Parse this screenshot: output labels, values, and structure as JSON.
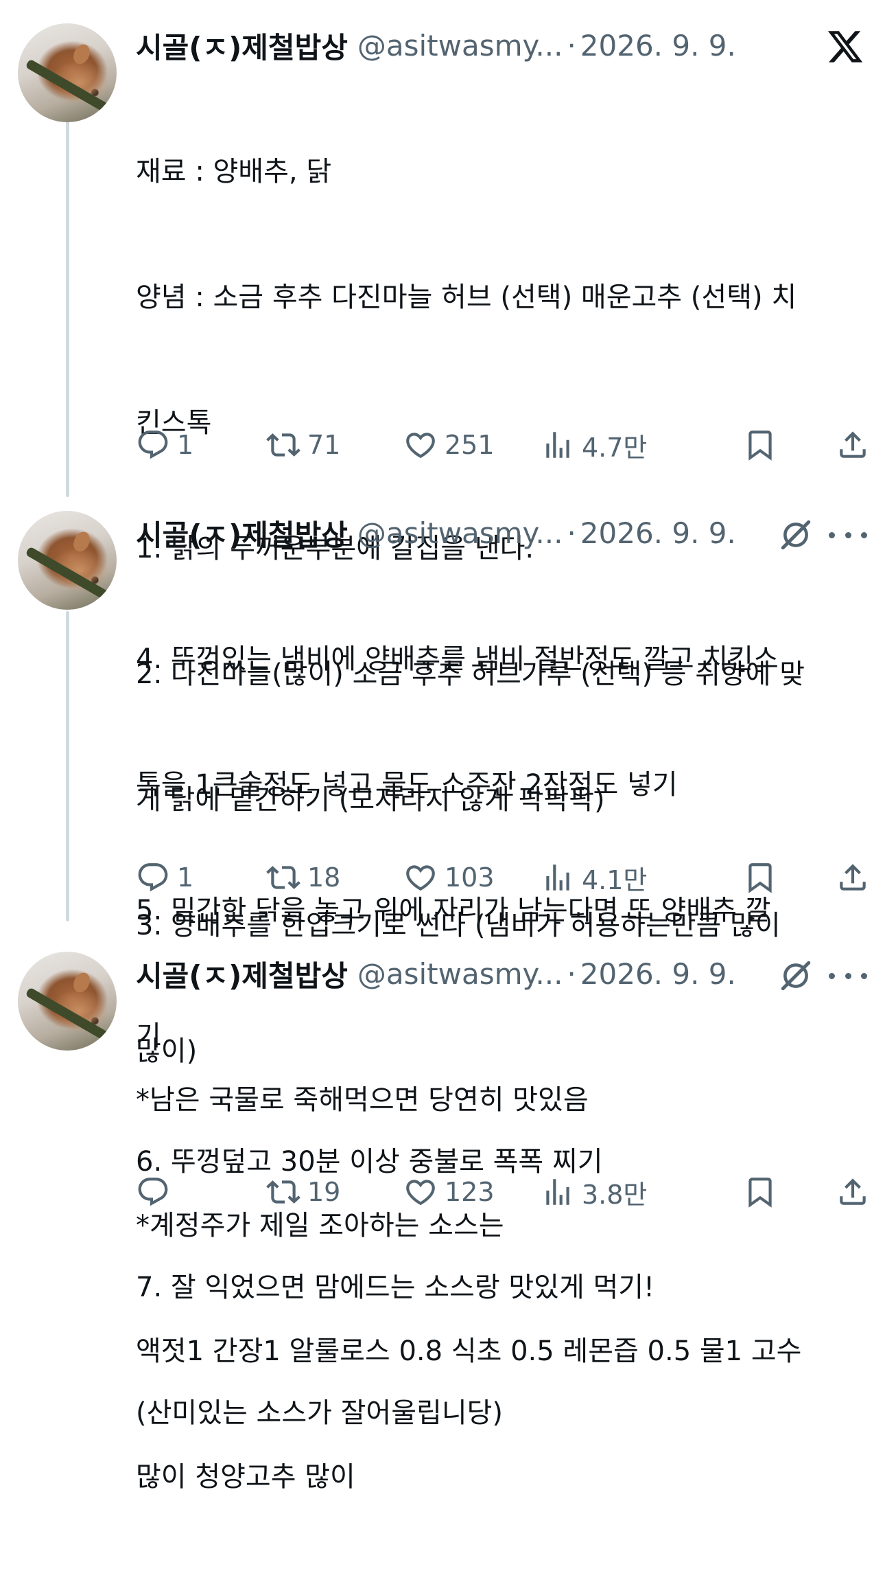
{
  "tweets": [
    {
      "author_name": "시골(ㅈ)제철밥상",
      "handle": "@asitwasmy...",
      "separator": "·",
      "date": "2026. 9. 9.",
      "top_right_icon": "x-logo-icon",
      "lines": [
        "재료 : 양배추, 닭",
        "양념 : 소금 후추 다진마늘 허브 (선택) 매운고추 (선택) 치",
        "킨스톡",
        "1. 닭의 두꺼운부분에 칼집을 낸다.",
        "2. 다진마늘(많이) 소금 후추 허브가루 (선택) 등 취향에 맞",
        "게 닭에 밑간하기 (모자라지 않게 팍팍팍)",
        "3. 양배추를 한입크기로 썬다 (냄비가 허용하는만큼 많이",
        "많이)"
      ],
      "actions": {
        "reply": "1",
        "repost": "71",
        "like": "251",
        "views": "4.7만"
      }
    },
    {
      "author_name": "시골(ㅈ)제철밥상",
      "handle": "@asitwasmy...",
      "separator": "·",
      "date": "2026. 9. 9.",
      "top_right_icon": "grok-icon",
      "lines": [
        "4. 뚜껑있는 냄비에 양배추를 냄비 절반정도 깔고 치킨스",
        "톡을 1큰술정도 넣고 물도 소주잔 2잔정도 넣기",
        "5. 밑간한 닭을 놓고 위에 자리가 남는다면 또 양배추 깔",
        "기",
        "6. 뚜껑덮고 30분 이상 중불로 폭폭 찌기",
        "7. 잘 익었으면 맘에드는 소스랑 맛있게 먹기!",
        "(산미있는 소스가 잘어울립니당)"
      ],
      "actions": {
        "reply": "1",
        "repost": "18",
        "like": "103",
        "views": "4.1만"
      }
    },
    {
      "author_name": "시골(ㅈ)제철밥상",
      "handle": "@asitwasmy...",
      "separator": "·",
      "date": "2026. 9. 9.",
      "top_right_icon": "grok-icon",
      "lines": [
        "*남은 국물로 죽해먹으면 당연히 맛있음",
        "*계정주가 제일 조아하는 소스는",
        "액젓1 간장1 알룰로스 0.8 식초 0.5 레몬즙 0.5 물1 고수",
        "많이 청양고추 많이"
      ],
      "actions": {
        "reply": "",
        "repost": "19",
        "like": "123",
        "views": "3.8만"
      }
    }
  ],
  "colors": {
    "text": "#0f1419",
    "secondary": "#536471",
    "thread_line": "#cfd9de"
  }
}
